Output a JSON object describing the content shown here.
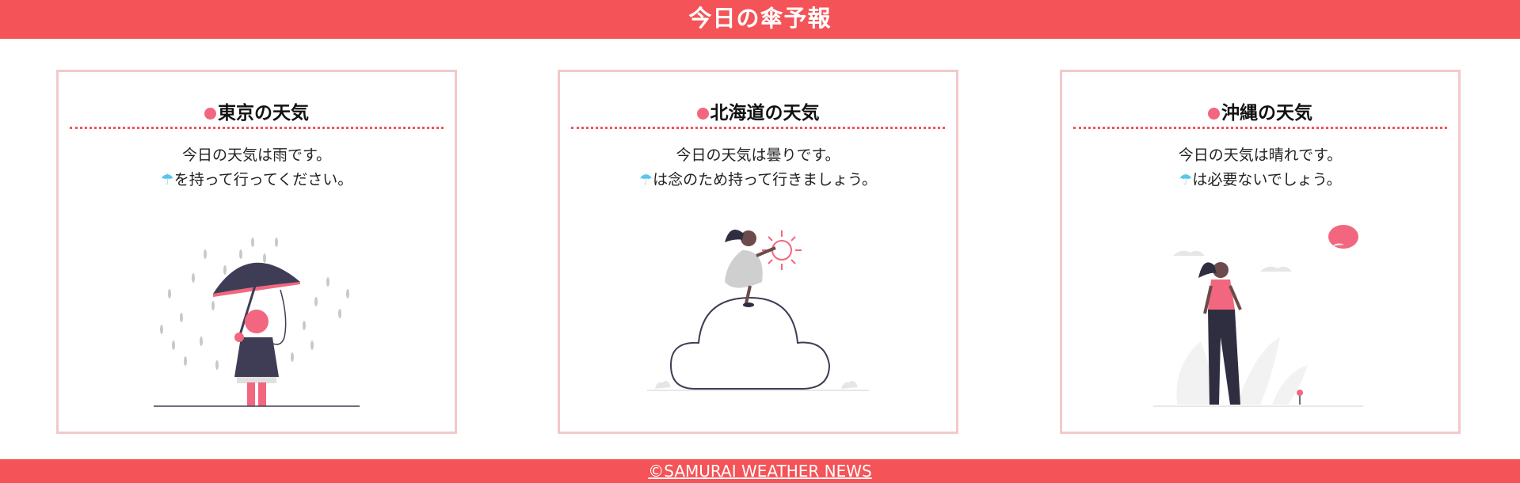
{
  "header": {
    "title": "今日の傘予報"
  },
  "cards": [
    {
      "title": "東京の天気",
      "line1": "今日の天気は雨です。",
      "umbrella_icon": "☂",
      "line2": "を持って行ってください。",
      "illustration": "person-with-umbrella-in-rain"
    },
    {
      "title": "北海道の天気",
      "line1": "今日の天気は曇りです。",
      "umbrella_icon": "☂",
      "line2": "は念のため持って行きましょう。",
      "illustration": "person-on-cloud-with-sun"
    },
    {
      "title": "沖縄の天気",
      "line1": "今日の天気は晴れです。",
      "umbrella_icon": "☂",
      "line2": "は必要ないでしょう。",
      "illustration": "person-walking-sunny"
    }
  ],
  "footer": {
    "copyright": "©SAMURAI WEATHER NEWS"
  },
  "colors": {
    "brand_red": "#f45357",
    "card_border": "#f3c9c9",
    "accent_pink": "#f2677f",
    "umbrella_blue": "#5bc5ea"
  }
}
